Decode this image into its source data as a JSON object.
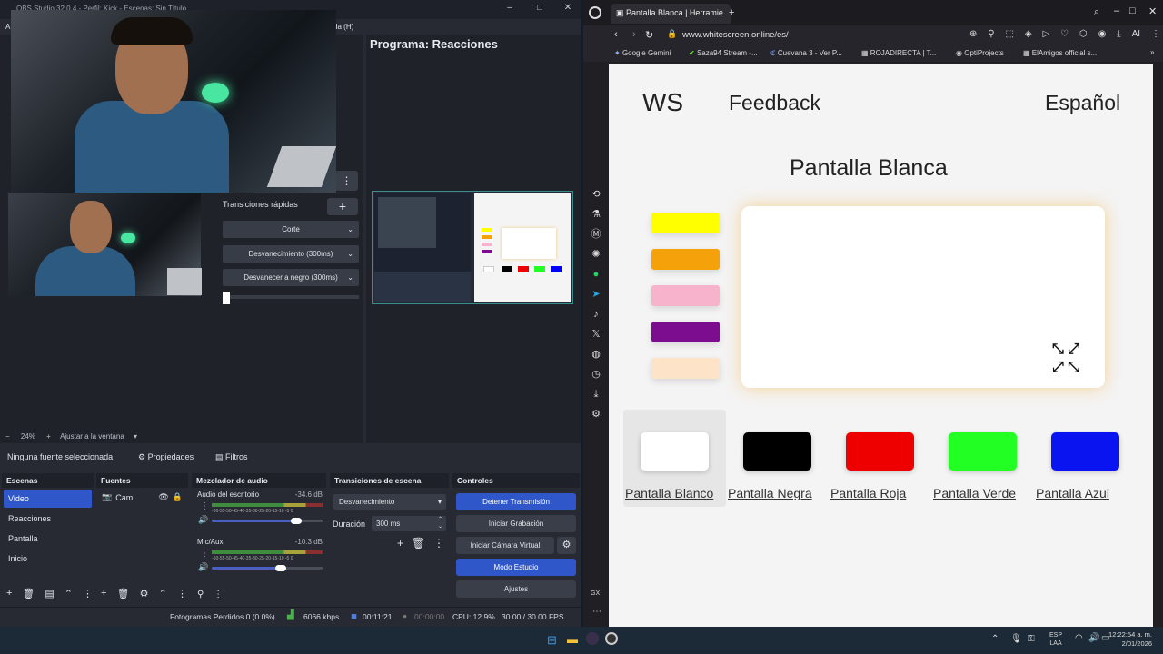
{
  "obs": {
    "window_title": "OBS Studio 32.0.4 - Perfil: Kick - Escenas: Sin Título",
    "menu": [
      "A",
      "yuda (H)"
    ],
    "program_label": "Programa: Reacciones",
    "quick_transitions": {
      "label": "Transiciones rápidas",
      "add": "+",
      "items": [
        "Corte",
        "Desvanecimiento (300ms)",
        "Desvanecer a negro (300ms)"
      ]
    },
    "zoom": {
      "minus": "−",
      "value": "24%",
      "plus": "+",
      "fit": "Ajustar a la ventana"
    },
    "source_toolbar": {
      "none_selected": "Ninguna fuente seleccionada",
      "properties": "Propiedades",
      "filters": "Filtros"
    },
    "scenes": {
      "title": "Escenas",
      "items": [
        "Video",
        "Reacciones",
        "Pantalla",
        "Inicio"
      ],
      "selected": 0
    },
    "sources": {
      "title": "Fuentes",
      "items": [
        "Cam"
      ]
    },
    "mixer": {
      "title": "Mezclador de audio",
      "channels": [
        {
          "name": "Audio del escritorio",
          "db": "-34.6 dB",
          "vol": 0.76
        },
        {
          "name": "Mic/Aux",
          "db": "-10.3 dB",
          "vol": 0.62
        }
      ],
      "scale": "-60-55-50-45-40-35-30-25-20-15-10 -5 0"
    },
    "scene_transitions": {
      "title": "Transiciones de escena",
      "selected": "Desvanecimiento",
      "duration_label": "Duración",
      "duration": "300 ms"
    },
    "controls": {
      "title": "Controles",
      "stop_stream": "Detener Transmisión",
      "start_record": "Iniciar Grabación",
      "start_vcam": "Iniciar Cámara Virtual",
      "studio_mode": "Modo Estudio",
      "settings": "Ajustes"
    },
    "status": {
      "dropped": "Fotogramas Perdidos 0 (0.0%)",
      "kbps": "6066 kbps",
      "stream_time": "00:11:21",
      "rec_time": "00:00:00",
      "cpu": "CPU: 12.9%",
      "fps": "30.00 / 30.00 FPS"
    }
  },
  "browser": {
    "tab_title": "Pantalla Blanca | Herramie",
    "url": "www.whitescreen.online/es/",
    "bookmarks": [
      "Google Gemini",
      "Saza94 Stream -...",
      "Cuevana 3 - Ver P...",
      "ROJADIRECTA | T...",
      "OptiProjects",
      "ElAmigos official s..."
    ]
  },
  "site": {
    "logo": "WS",
    "feedback": "Feedback",
    "language": "Español",
    "heading": "Pantalla Blanca",
    "side_swatches": [
      "#ffff00",
      "#f5a20a",
      "#f7b3cc",
      "#7b0d8e",
      "#fde3c8"
    ],
    "colors": [
      {
        "label": "Pantalla Blanco",
        "hex": "#ffffff"
      },
      {
        "label": "Pantalla Negra",
        "hex": "#000000"
      },
      {
        "label": "Pantalla Roja",
        "hex": "#ee0000"
      },
      {
        "label": "Pantalla Verde",
        "hex": "#22ff22"
      },
      {
        "label": "Pantalla Azul",
        "hex": "#0a14f0"
      }
    ]
  },
  "taskbar": {
    "lang1": "ESP",
    "lang2": "LAA",
    "time": "12:22:54 a. m.",
    "date": "2/01/2026"
  }
}
